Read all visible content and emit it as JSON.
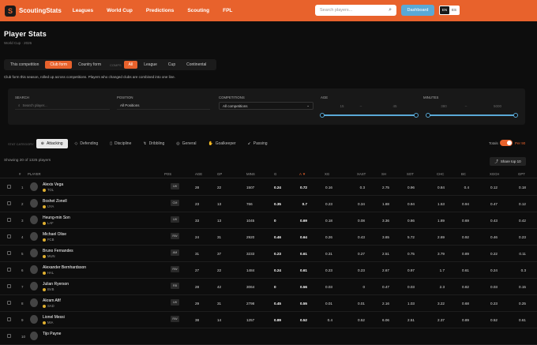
{
  "nav": {
    "brand": "ScoutingStats",
    "logo_glyph": "S",
    "items": [
      "Leagues",
      "World Cup",
      "Predictions",
      "Scouting",
      "FPL"
    ],
    "search_placeholder": "Search players...",
    "dashboard": "Dashboard",
    "lang_on": "EN",
    "lang_off": "ES"
  },
  "page": {
    "title": "Player Stats",
    "subtitle": "World Cup · 2026",
    "scope_tabs": [
      "This competition",
      "Club form",
      "Country form"
    ],
    "comps_label": "COMPS",
    "comp_tabs": [
      "All",
      "League",
      "Cup",
      "Continental"
    ],
    "note": "Club form this season, rolled up across competitions. Players who changed clubs are combined into one line."
  },
  "filters": {
    "search_label": "SEARCH",
    "search_placeholder": "Search player...",
    "position_label": "POSITION",
    "position_value": "All Positions",
    "competitions_label": "COMPETITIONS",
    "competitions_value": "All competitions",
    "age_label": "AGE",
    "age_min": "15",
    "age_max": "45",
    "minutes_label": "MINUTES",
    "minutes_min": "380",
    "minutes_max": "5000"
  },
  "categories": {
    "label": "STAT CATEGORY",
    "items": [
      {
        "label": "Attacking",
        "icon": "⊕"
      },
      {
        "label": "Defending",
        "icon": "◇"
      },
      {
        "label": "Discipline",
        "icon": "▯"
      },
      {
        "label": "Dribbling",
        "icon": "↯"
      },
      {
        "label": "General",
        "icon": "◎"
      },
      {
        "label": "Goalkeeper",
        "icon": "✋"
      },
      {
        "label": "Passing",
        "icon": "➹"
      }
    ],
    "totals": "Totals",
    "per90": "Per 90"
  },
  "summary": {
    "showing": "Showing 20 of 1325 players",
    "share": "Share top 10"
  },
  "table": {
    "headers": [
      "#",
      "PLAYER",
      "POS",
      "AGE",
      "GP",
      "MINS",
      "G",
      "A ▼",
      "XG",
      "XAST",
      "SH",
      "SOT",
      "CHC",
      "BC",
      "XGCH",
      "GPT"
    ],
    "rows": [
      {
        "rank": "1",
        "name": "Alexis Vega",
        "club": "TOL",
        "pos": "LW",
        "age": "28",
        "gp": "22",
        "mins": "1507",
        "g": "0.24",
        "a": "0.72",
        "xg": "0.16",
        "xast": "0.3",
        "sh": "2.75",
        "sot": "0.96",
        "chc": "0.84",
        "bc": "0.4",
        "xgch": "0.12",
        "gpt": "0.18"
      },
      {
        "rank": "2",
        "name": "Boshet Zonell",
        "club": "UYA",
        "pos": "CM",
        "age": "23",
        "gp": "13",
        "mins": "766",
        "g": "0.35",
        "a": "0.7",
        "xg": "0.23",
        "xast": "0.34",
        "sh": "1.88",
        "sot": "0.94",
        "chc": "1.53",
        "bc": "0.94",
        "xgch": "0.47",
        "gpt": "0.12"
      },
      {
        "rank": "3",
        "name": "Heung-min Son",
        "club": "LAF",
        "pos": "LW",
        "age": "33",
        "gp": "13",
        "mins": "1045",
        "g": "0",
        "a": "0.69",
        "xg": "0.18",
        "xast": "0.08",
        "sh": "3.36",
        "sot": "0.86",
        "chc": "1.89",
        "bc": "0.69",
        "xgch": "0.43",
        "gpt": "0.42"
      },
      {
        "rank": "4",
        "name": "Michael Olise",
        "club": "FCB",
        "pos": "RW",
        "age": "24",
        "gp": "31",
        "mins": "2920",
        "g": "0.46",
        "a": "0.64",
        "xg": "0.26",
        "xast": "0.43",
        "sh": "3.65",
        "sot": "5.72",
        "chc": "2.69",
        "bc": "0.92",
        "xgch": "0.46",
        "gpt": "0.23"
      },
      {
        "rank": "5",
        "name": "Bruno Fernandes",
        "club": "MUN",
        "pos": "AM",
        "age": "31",
        "gp": "37",
        "mins": "3233",
        "g": "0.23",
        "a": "0.61",
        "xg": "0.31",
        "xast": "0.27",
        "sh": "2.51",
        "sot": "0.75",
        "chc": "3.79",
        "bc": "0.89",
        "xgch": "0.22",
        "gpt": "0.11"
      },
      {
        "rank": "6",
        "name": "Alexander Bernhardsson",
        "club": "HAL",
        "pos": "RW",
        "age": "27",
        "gp": "22",
        "mins": "1484",
        "g": "0.24",
        "a": "0.61",
        "xg": "0.23",
        "xast": "0.23",
        "sh": "2.67",
        "sot": "0.97",
        "chc": "1.7",
        "bc": "0.61",
        "xgch": "0.24",
        "gpt": "0.3"
      },
      {
        "rank": "7",
        "name": "Julian Ryerson",
        "club": "BVB",
        "pos": "RB",
        "age": "28",
        "gp": "42",
        "mins": "3064",
        "g": "0",
        "a": "0.56",
        "xg": "0.03",
        "xast": "0",
        "sh": "0.47",
        "sot": "0.03",
        "chc": "2.3",
        "bc": "0.82",
        "xgch": "0.03",
        "gpt": "0.15"
      },
      {
        "rank": "8",
        "name": "Akram Afif",
        "club": "SAD",
        "pos": "LW",
        "age": "29",
        "gp": "31",
        "mins": "2798",
        "g": "0.45",
        "a": "0.55",
        "xg": "0.01",
        "xast": "0.01",
        "sh": "2.16",
        "sot": "1.03",
        "chc": "3.22",
        "bc": "0.68",
        "xgch": "0.23",
        "gpt": "0.25"
      },
      {
        "rank": "9",
        "name": "Lionel Messi",
        "club": "MIA",
        "pos": "RW",
        "age": "38",
        "gp": "14",
        "mins": "1257",
        "g": "0.89",
        "a": "0.52",
        "xg": "0.4",
        "xast": "0.52",
        "sh": "6.06",
        "sot": "2.51",
        "chc": "2.37",
        "bc": "0.89",
        "xgch": "0.52",
        "gpt": "0.61"
      },
      {
        "rank": "10",
        "name": "Tijo Payne",
        "club": "",
        "pos": "",
        "age": "",
        "gp": "",
        "mins": "",
        "g": "",
        "a": "",
        "xg": "",
        "xast": "",
        "sh": "",
        "sot": "",
        "chc": "",
        "bc": "",
        "xgch": "",
        "gpt": ""
      }
    ]
  },
  "colors": {
    "accent": "#e8622c",
    "blue": "#5aa9d6",
    "bg": "#0d0d0d"
  }
}
